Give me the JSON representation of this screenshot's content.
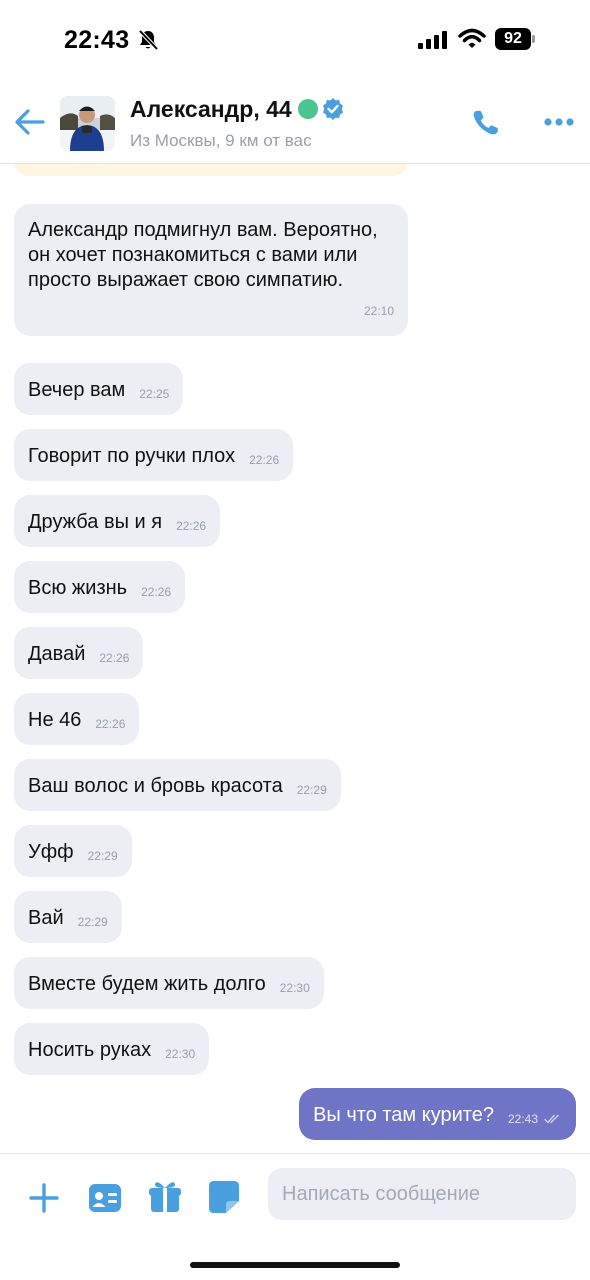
{
  "status_bar": {
    "time": "22:43",
    "battery": "92",
    "icons": [
      "bell-slash-icon",
      "signal-icon",
      "wifi-icon",
      "battery-icon"
    ]
  },
  "header": {
    "name": "Александр, 44",
    "location": "Из Москвы, 9 км от вас",
    "online_color": "#4cc48f",
    "accent_color": "#4a9fde",
    "icons": [
      "back-arrow-icon",
      "verified-icon",
      "phone-icon",
      "more-icon"
    ]
  },
  "messages": [
    {
      "text": "Александр подмигнул вам. Вероятно, он хочет познакомиться с вами или просто выражает свою симпатию.",
      "time": "22:10",
      "direction": "in"
    },
    {
      "text": "Вечер вам",
      "time": "22:25",
      "direction": "in"
    },
    {
      "text": "Говорит по ручки плох",
      "time": "22:26",
      "direction": "in"
    },
    {
      "text": "Дружба вы и я",
      "time": "22:26",
      "direction": "in"
    },
    {
      "text": "Всю жизнь",
      "time": "22:26",
      "direction": "in"
    },
    {
      "text": "Давай",
      "time": "22:26",
      "direction": "in"
    },
    {
      "text": "Не 46",
      "time": "22:26",
      "direction": "in"
    },
    {
      "text": "Ваш волос и бровь красота",
      "time": "22:29",
      "direction": "in"
    },
    {
      "text": "Уфф",
      "time": "22:29",
      "direction": "in"
    },
    {
      "text": "Вай",
      "time": "22:29",
      "direction": "in"
    },
    {
      "text": "Вместе будем жить долго",
      "time": "22:30",
      "direction": "in"
    },
    {
      "text": "Носить руках",
      "time": "22:30",
      "direction": "in"
    },
    {
      "text": "Вы что там курите?",
      "time": "22:43",
      "direction": "out",
      "status": "read"
    }
  ],
  "composer": {
    "placeholder": "Написать сообщение",
    "value": "",
    "icons": [
      "plus-icon",
      "contact-card-icon",
      "gift-icon",
      "sticker-icon"
    ]
  },
  "colors": {
    "incoming_bubble": "#eceef4",
    "outgoing_bubble": "#6f74c6"
  }
}
